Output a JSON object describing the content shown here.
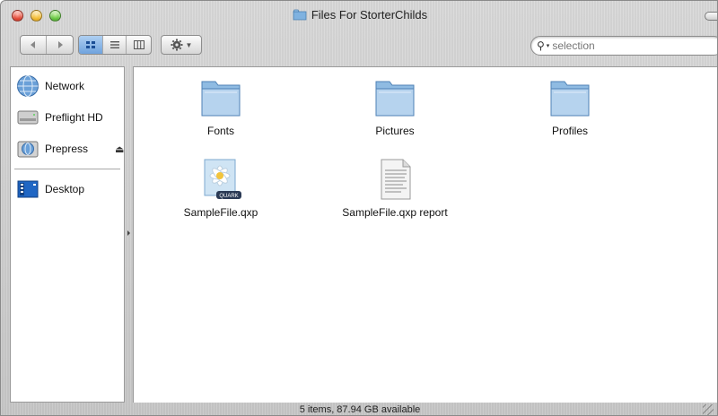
{
  "window": {
    "title": "Files For StorterChilds"
  },
  "toolbar": {
    "back_icon": "back-arrow-icon",
    "forward_icon": "forward-arrow-icon",
    "view_modes": [
      "icon-view",
      "list-view",
      "column-view"
    ],
    "active_view": "icon-view",
    "action_icon": "gear-icon",
    "search": {
      "placeholder": "selection",
      "value": ""
    }
  },
  "sidebar": {
    "items": [
      {
        "label": "Network",
        "icon": "network-globe-icon"
      },
      {
        "label": "Preflight HD",
        "icon": "hard-drive-icon"
      },
      {
        "label": "Prepress",
        "icon": "network-volume-icon",
        "eject": "⏏"
      },
      {
        "label": "Desktop",
        "icon": "desktop-icon"
      }
    ]
  },
  "files": [
    {
      "name": "Fonts",
      "kind": "folder"
    },
    {
      "name": "Pictures",
      "kind": "folder"
    },
    {
      "name": "Profiles",
      "kind": "folder"
    },
    {
      "name": "SampleFile.qxp",
      "kind": "quark-document",
      "badge": "QUARK"
    },
    {
      "name": "SampleFile.qxp report",
      "kind": "text-document"
    }
  ],
  "status": {
    "text": "5 items, 87.94 GB available"
  },
  "colors": {
    "folder_blue": "#7fb2e0",
    "selected_view": "#6fa3de"
  }
}
